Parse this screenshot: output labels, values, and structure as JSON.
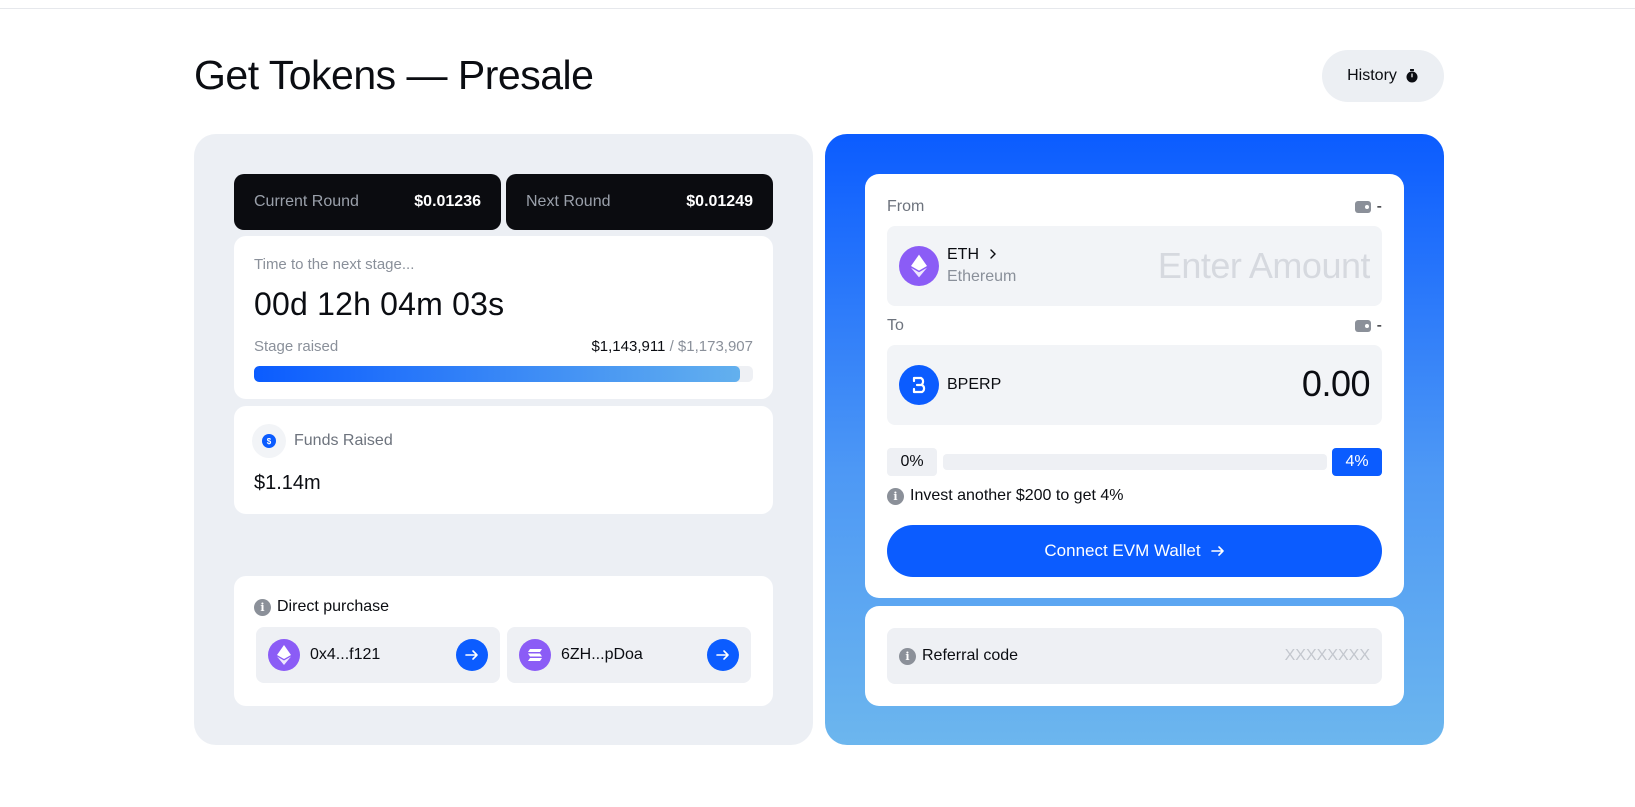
{
  "header": {
    "title": "Get Tokens — Presale",
    "history_label": "History"
  },
  "rounds": {
    "current": {
      "label": "Current Round",
      "price": "$0.01236"
    },
    "next": {
      "label": "Next Round",
      "price": "$0.01249"
    }
  },
  "stage": {
    "subtitle": "Time to the next stage...",
    "timer": "00d 12h 04m 03s",
    "raised_label": "Stage raised",
    "raised_amount": "$1,143,911",
    "raised_separator": " / ",
    "raised_target": "$1,173,907",
    "progress_fraction": 0.974
  },
  "funds": {
    "label": "Funds Raised",
    "value": "$1.14m"
  },
  "direct_purchase": {
    "title": "Direct purchase",
    "eth_address": "0x4...f121",
    "sol_address": "6ZH...pDoa"
  },
  "swap": {
    "from_label": "From",
    "to_label": "To",
    "wallet_balance_from": "-",
    "wallet_balance_to": "-",
    "from_token": {
      "symbol": "ETH",
      "network": "Ethereum",
      "amount_placeholder": "Enter Amount"
    },
    "to_token": {
      "symbol": "BPERP",
      "amount": "0.00"
    },
    "bonus_min": "0%",
    "bonus_max": "4%",
    "bonus_fraction": 0,
    "invest_note": "Invest another $200  to get 4%",
    "connect_label": "Connect EVM Wallet"
  },
  "referral": {
    "label": "Referral code",
    "placeholder": "XXXXXXXX"
  },
  "colors": {
    "accent": "#0b5cff",
    "eth_purple": "#8b5cf6",
    "dark_card": "#0b0c10",
    "panel_bg": "#eceff4"
  }
}
